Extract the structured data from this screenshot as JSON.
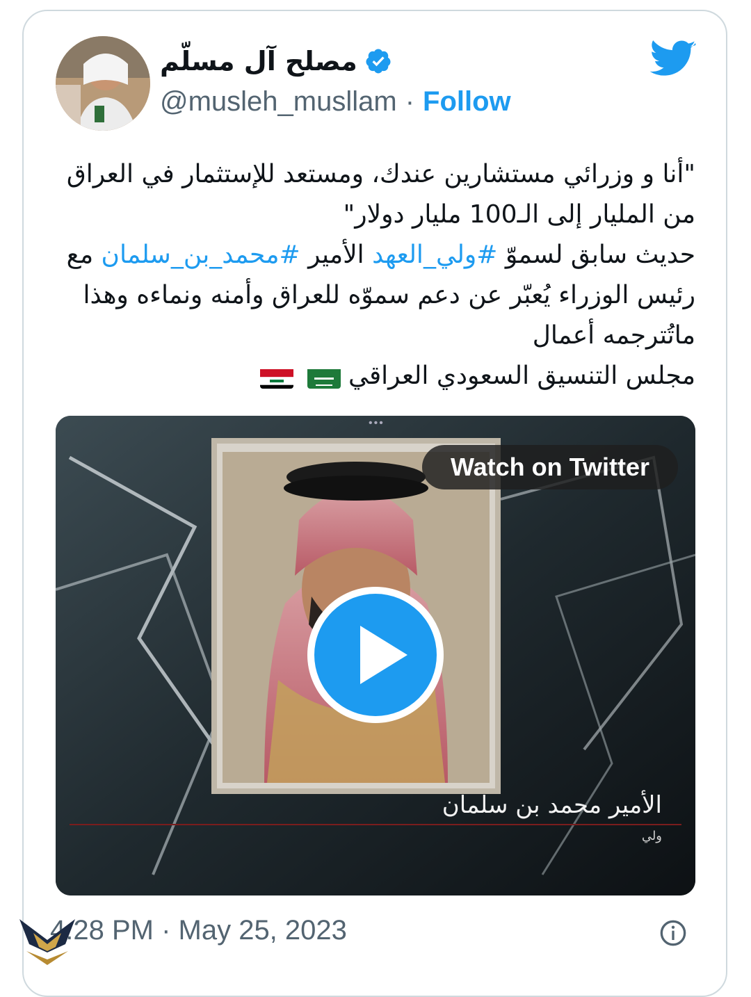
{
  "author": {
    "display_name": "مصلح آل مسلّم",
    "handle": "@musleh_musllam",
    "separator": "·",
    "follow_label": "Follow",
    "verified": true
  },
  "tweet": {
    "line1": "\"أنا و وزرائي مستشارين عندك، ومستعد للإستثمار في العراق من المليار إلى الـ100 مليار دولار\"",
    "line2_before": "حديث سابق لسموّ ",
    "hashtag1": "#ولي_العهد",
    "line2_middle": " الأمير ",
    "hashtag2": "#محمد_بن_سلمان",
    "line2_after": " مع رئيس الوزراء يُعبّر عن دعم سموّه للعراق وأمنه ونماءه وهذا ماتُترجمه أعمال",
    "line3": "مجلس التنسيق السعودي العراقي"
  },
  "media": {
    "watch_label": "Watch on Twitter",
    "caption_main": "الأمير محمد بن سلمان",
    "caption_sub": "ولي",
    "more_dots": "•••"
  },
  "footer": {
    "timestamp": "4:28 PM · May 25, 2023"
  },
  "colors": {
    "brand": "#1d9bf0",
    "text": "#0f1419",
    "secondary": "#536471"
  },
  "icons": [
    "verified-badge-icon",
    "twitter-bird-icon",
    "play-icon",
    "info-icon",
    "saudi-flag-icon",
    "iraq-flag-icon"
  ]
}
